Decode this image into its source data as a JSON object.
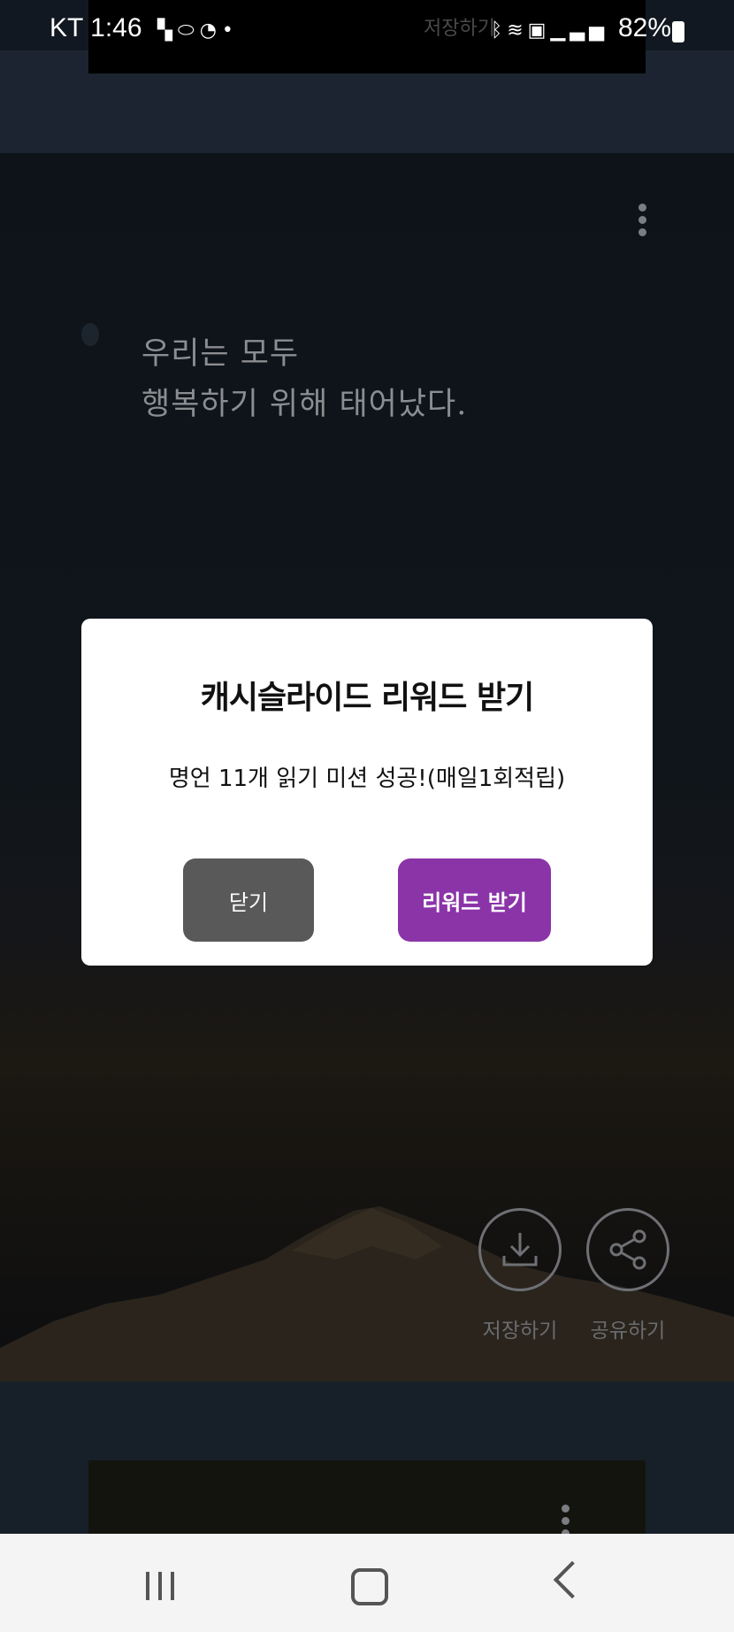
{
  "status_bar": {
    "carrier_time": "KT 1:46",
    "left_icons": [
      "notification-icon",
      "pill-icon",
      "clock-icon",
      "dot-icon"
    ],
    "ghost_text": "저장하기",
    "right_icons": [
      "bluetooth-icon",
      "wifi-icon",
      "hd-icon",
      "signal-icon"
    ],
    "battery": "82%"
  },
  "quote": {
    "line1": "우리는 모두",
    "line2": "행복하기 위해 태어났다."
  },
  "actions": {
    "save_label": "저장하기",
    "share_label": "공유하기"
  },
  "dialog": {
    "title": "캐시슬라이드 리워드 받기",
    "message": "명언 11개 읽기 미션 성공!(매일1회적립)",
    "close_label": "닫기",
    "reward_label": "리워드 받기"
  },
  "colors": {
    "reward_button": "#8b34a8",
    "close_button": "#595959"
  }
}
